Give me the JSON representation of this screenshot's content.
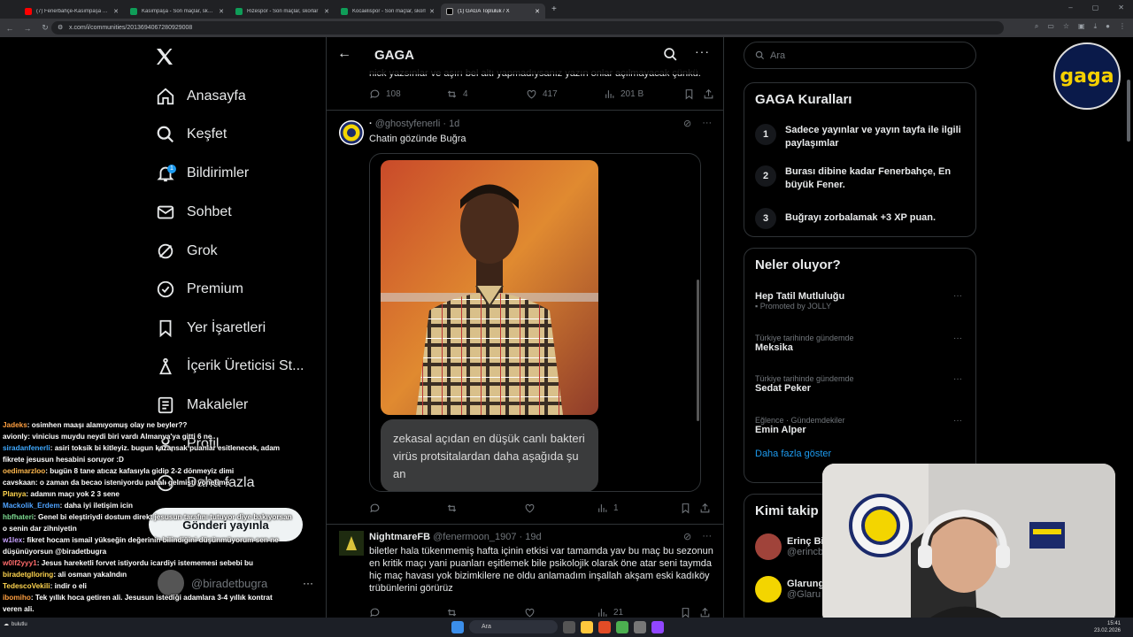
{
  "browser": {
    "tabs": [
      {
        "label": "(7) Fenerbahçe-Kasımpaşa Maç",
        "color": "#ff0000",
        "active": false
      },
      {
        "label": "Kasımpaşa - Son maçlar, skorlar",
        "color": "#0f9d58",
        "active": false
      },
      {
        "label": "Rizespor - Son maçlar, skorlar",
        "color": "#0f9d58",
        "active": false
      },
      {
        "label": "Kocaelispor - Son maçlar, skorl",
        "color": "#0f9d58",
        "active": false
      },
      {
        "label": "(1) GAGA Topluluk / X",
        "color": "#000000",
        "active": true
      }
    ],
    "url": "x.com/i/communities/2013694067280929008"
  },
  "nav": {
    "items": [
      {
        "label": "Anasayfa",
        "icon": "home-icon"
      },
      {
        "label": "Keşfet",
        "icon": "search-icon"
      },
      {
        "label": "Bildirimler",
        "icon": "bell-icon",
        "badge": "1"
      },
      {
        "label": "Sohbet",
        "icon": "mail-icon"
      },
      {
        "label": "Grok",
        "icon": "grok-icon"
      },
      {
        "label": "Premium",
        "icon": "verified-icon"
      },
      {
        "label": "Yer İşaretleri",
        "icon": "bookmark-icon"
      },
      {
        "label": "İçerik Üreticisi St...",
        "icon": "creator-icon"
      },
      {
        "label": "Makaleler",
        "icon": "article-icon"
      },
      {
        "label": "Profil",
        "icon": "profile-icon"
      },
      {
        "label": "Daha fazla",
        "icon": "more-circle-icon"
      }
    ],
    "post_button": "Gönderi yayınla",
    "user_handle": "@biradetbugra",
    "user_more": "···"
  },
  "chat": [
    {
      "nick": "Jadeks",
      "color": "#ff9f40",
      "text": ": osimhen maaşı alamıyomuş olay ne beyler??"
    },
    {
      "nick": "avionly",
      "color": "#ffffff",
      "text": ": vinicius muydu neydi biri vardı Almanya'ya gitti 6 ne"
    },
    {
      "nick": "siradanfenerli",
      "color": "#3fa9ff",
      "text": ": asiri toksik bi kitleyiz. bugun kazansak puanlar esitlenecek, adam fikrete jesusun hesabini soruyor :D"
    },
    {
      "nick": "oedimarzloo",
      "color": "#ffb84d",
      "text": ": bugün 8 tane atıcaz kafasıyla gidip 2-2 dönmeyiz dimi"
    },
    {
      "nick": "cavskaan",
      "color": "#ffffff",
      "text": ": o zaman da becao isteniyordu pahalı gelmişti yönetime"
    },
    {
      "nick": "Planya",
      "color": "#ffd54f",
      "text": ": adamın maçı yok 2 3 sene"
    },
    {
      "nick": "Mackolik_Erdem",
      "color": "#4fa3ff",
      "text": ": daha iyi iletişim icin"
    },
    {
      "nick": "hbfhateri",
      "color": "#7bd88f",
      "text": ": Genel bi eleştiriydi dostum direkt jesusun tarafını tutuyor diye bakıyorsan o senin dar zihniyetin"
    },
    {
      "nick": "w1lex",
      "color": "#c8a2ff",
      "text": ": fikret hocam ismail yükseğin değerinin bilindiğini düşünmüyorum sen ne düşünüyorsun @biradetbugra"
    },
    {
      "nick": "w0lf2yyy1",
      "color": "#ff6b6b",
      "text": ": Jesus hareketli forvet istiyordu icardiyi istememesi sebebi bu"
    },
    {
      "nick": "biradetglloring",
      "color": "#ffd54f",
      "text": ": ali osman yakalndın"
    },
    {
      "nick": "TedescoVekili",
      "color": "#ffd54f",
      "text": ": indir o eli"
    },
    {
      "nick": "ibomiho",
      "color": "#ff9f40",
      "text": ": Tek yıllık hoca getiren ali. Jesusun istediği adamlara 3-4 yıllık kontrat veren ali."
    }
  ],
  "community": {
    "title": "GAGA",
    "back": "←",
    "more": "···"
  },
  "prev_post": {
    "text": "nick yazsınlar ve aşırı bel altı yapmadıysanız yazın onlar açılmayacak çünkü.",
    "replies": "108",
    "reposts": "4",
    "likes": "417",
    "views": "201 B"
  },
  "post1": {
    "name": "·",
    "handle": "@ghostyfenerli",
    "time": "· 1d",
    "text": "Chatin gözünde Buğra",
    "image_caption": "zekasal açıdan en düşük canlı bakteri virüs protsitalardan daha aşağıda şu an",
    "views": "1"
  },
  "post2": {
    "name": "NightmareFB",
    "handle": "@fenermoon_1907",
    "time": "· 19d",
    "text": "biletler hala tükenmemiş hafta içinin etkisi var tamamda yav bu maç bu sezonun en kritik maçı yani puanları eşitlemek bile psikolojik olarak öne atar seni taymda hiç maç havası yok bizimkilere ne oldu anlamadım inşallah akşam eski kadıköy trübünlerini görürüz",
    "views": "21"
  },
  "right": {
    "search_placeholder": "Ara",
    "rules_title": "GAGA Kuralları",
    "rules": [
      {
        "num": "1",
        "text": "Sadece yayınlar ve yayın tayfa ile ilgili paylaşımlar"
      },
      {
        "num": "2",
        "text": "Burası dibine kadar Fenerbahçe, En büyük Fener."
      },
      {
        "num": "3",
        "text": "Buğrayı zorbalamak +3 XP puan."
      }
    ],
    "trends_title": "Neler oluyor?",
    "trends": [
      {
        "meta": "",
        "name": "Hep Tatil Mutluluğu",
        "sub": "Promoted by JOLLY"
      },
      {
        "meta": "Türkiye tarihinde gündemde",
        "name": "Meksika",
        "sub": ""
      },
      {
        "meta": "Türkiye tarihinde gündemde",
        "name": "Sedat Peker",
        "sub": ""
      },
      {
        "meta": "Eğlence · Gündemdekiler",
        "name": "Emin Alper",
        "sub": ""
      }
    ],
    "show_more": "Daha fazla göster",
    "follow_title": "Kimi takip",
    "follows": [
      {
        "name": "Erinç Bi",
        "handle": "@erincb"
      },
      {
        "name": "Glarung",
        "handle": "@Glaru"
      }
    ]
  },
  "logo_text": "gaga",
  "taskbar": {
    "search": "Ara",
    "time": "15:41",
    "date": "23.02.2026",
    "weather": "bulutlu"
  }
}
